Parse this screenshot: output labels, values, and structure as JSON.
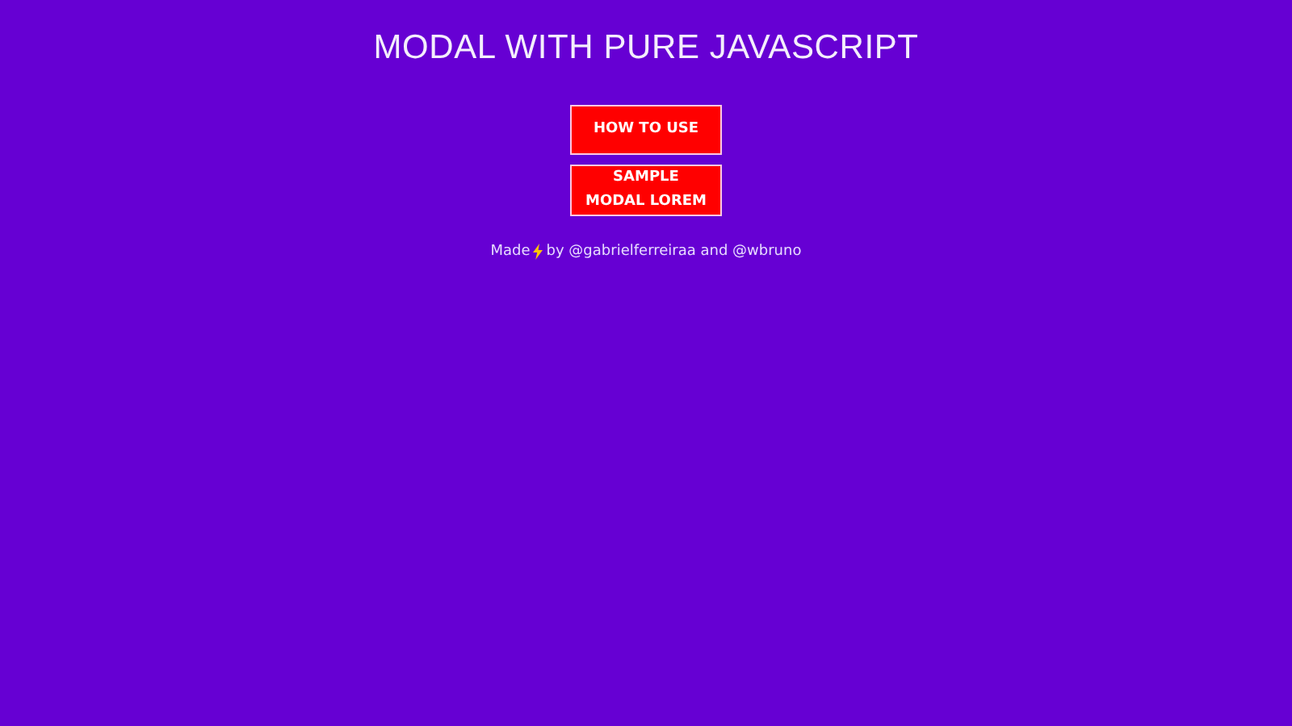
{
  "title": "MODAL WITH PURE JAVASCRIPT",
  "buttons": [
    "HOW TO USE",
    "SAMPLE MODAL LOREM"
  ],
  "footer": {
    "before": "Made",
    "after": "by @gabrielferreiraa and @wbruno"
  }
}
